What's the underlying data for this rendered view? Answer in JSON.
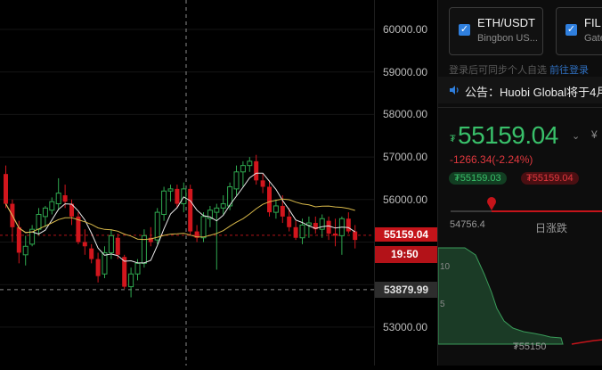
{
  "chart_data": {
    "type": "candlestick",
    "y_axis_ticks": [
      60000,
      59000,
      58000,
      57000,
      56000,
      55000,
      54000,
      53000
    ],
    "y_axis_tick_labels": [
      "60000.00",
      "59000.00",
      "58000.00",
      "57000.00",
      "56000.00",
      "55000.00",
      "54000.00",
      "53000.00"
    ],
    "ylim": [
      52700,
      60700
    ],
    "last_price": 55159.04,
    "last_price_label": "55159.04",
    "countdown_label": "19:50",
    "crosshair_price": 53879.99,
    "crosshair_price_label": "53879.99",
    "candles": [
      [
        56600,
        56800,
        55800,
        55900
      ],
      [
        55900,
        56000,
        55000,
        55350
      ],
      [
        55350,
        55500,
        54500,
        54750
      ],
      [
        54700,
        55150,
        54450,
        54900
      ],
      [
        54950,
        55400,
        54900,
        55300
      ],
      [
        55300,
        55800,
        55150,
        55650
      ],
      [
        55600,
        55850,
        55350,
        55800
      ],
      [
        55750,
        56050,
        55650,
        55950
      ],
      [
        55900,
        56500,
        55750,
        56150
      ],
      [
        56100,
        56350,
        55800,
        55950
      ],
      [
        55900,
        56000,
        55400,
        55600
      ],
      [
        55600,
        55700,
        54950,
        55000
      ],
      [
        55000,
        55300,
        54700,
        54900
      ],
      [
        54850,
        54950,
        54500,
        54600
      ],
      [
        54600,
        54750,
        54050,
        54200
      ],
      [
        54250,
        54900,
        54150,
        54750
      ],
      [
        54750,
        55300,
        54600,
        55150
      ],
      [
        55100,
        55200,
        54600,
        54700
      ],
      [
        54650,
        54700,
        53900,
        53950
      ],
      [
        53950,
        54400,
        53700,
        54250
      ],
      [
        54250,
        54600,
        54100,
        54500
      ],
      [
        54500,
        55300,
        54400,
        55150
      ],
      [
        55100,
        55350,
        54900,
        55000
      ],
      [
        55050,
        55800,
        54950,
        55700
      ],
      [
        55650,
        56300,
        55500,
        56200
      ],
      [
        56200,
        56350,
        55950,
        56250
      ],
      [
        56250,
        56350,
        55800,
        55900
      ],
      [
        55900,
        56400,
        55700,
        56250
      ],
      [
        56250,
        56350,
        55150,
        55250
      ],
      [
        55250,
        55400,
        55000,
        55100
      ],
      [
        55100,
        55700,
        55000,
        55600
      ],
      [
        55550,
        55850,
        55350,
        55750
      ],
      [
        55700,
        55900,
        54350,
        55800
      ],
      [
        55800,
        56100,
        55650,
        55900
      ],
      [
        55850,
        56400,
        55750,
        56300
      ],
      [
        56250,
        56800,
        56100,
        56650
      ],
      [
        56650,
        56900,
        56300,
        56800
      ],
      [
        56800,
        57000,
        56650,
        56900
      ],
      [
        56900,
        57050,
        56350,
        56450
      ],
      [
        56450,
        56600,
        56150,
        56300
      ],
      [
        56300,
        56450,
        55600,
        55700
      ],
      [
        55700,
        56000,
        55550,
        55850
      ],
      [
        55850,
        56100,
        55450,
        55600
      ],
      [
        55600,
        55800,
        55250,
        55350
      ],
      [
        55350,
        55500,
        55050,
        55100
      ],
      [
        55100,
        55550,
        54950,
        55400
      ],
      [
        55400,
        55600,
        55100,
        55450
      ],
      [
        55450,
        55600,
        55200,
        55300
      ],
      [
        55300,
        55650,
        55100,
        55550
      ],
      [
        55500,
        55600,
        55050,
        55200
      ],
      [
        55200,
        55550,
        54900,
        55150
      ],
      [
        55150,
        55600,
        54700,
        55550
      ],
      [
        55550,
        55700,
        55200,
        55250
      ],
      [
        55250,
        55400,
        54850,
        55050
      ]
    ]
  },
  "right_panel": {
    "cards": [
      {
        "title": "ETH/USDT",
        "subtitle": "Bingbon US..."
      },
      {
        "title": "FIL",
        "subtitle": "Gate"
      }
    ],
    "notice_faded": "登录后可同步个人自选",
    "notice_link": "前往登录",
    "notice_text": "公告：Huobi Global将于4月",
    "price_symbol": "₮",
    "price": "55159.04",
    "extra": "¥",
    "change": "-1266.34(-2.24%)",
    "bid_pill": "₮55159.03",
    "ask_pill": "₮55159.04",
    "range_low": "54756.4",
    "range_label": "日涨跌",
    "depth_ticks": [
      "10",
      "5"
    ],
    "depth_price": "₮55150",
    "colors": {
      "up": "#39c06a",
      "down": "#e0383e",
      "accent": "#2f7fde"
    }
  },
  "icons": {
    "checkbox": "check-icon",
    "speaker": "speaker-icon",
    "dropdown": "chevron-down-icon"
  }
}
